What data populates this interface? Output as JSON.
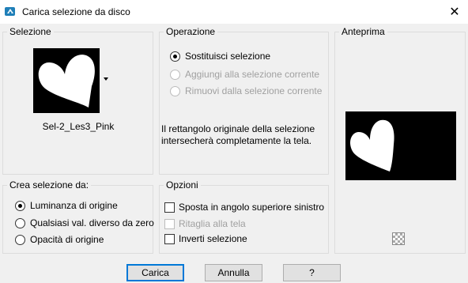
{
  "window": {
    "title": "Carica selezione da disco",
    "close_glyph": "✕",
    "icon": "paint-shop-icon"
  },
  "selezione": {
    "label": "Selezione",
    "filename": "Sel-2_Les3_Pink"
  },
  "operazione": {
    "label": "Operazione",
    "options": [
      {
        "label": "Sostituisci selezione",
        "checked": true,
        "enabled": true
      },
      {
        "label": "Aggiungi alla selezione corrente",
        "checked": false,
        "enabled": false
      },
      {
        "label": "Rimuovi dalla selezione corrente",
        "checked": false,
        "enabled": false
      }
    ],
    "info": "Il rettangolo originale della selezione intersecherà completamente la tela."
  },
  "anteprima": {
    "label": "Anteprima"
  },
  "crea": {
    "label": "Crea selezione da:",
    "options": [
      {
        "label": "Luminanza di origine",
        "checked": true
      },
      {
        "label": "Qualsiasi val. diverso da zero",
        "checked": false
      },
      {
        "label": "Opacità di origine",
        "checked": false
      }
    ]
  },
  "opzioni": {
    "label": "Opzioni",
    "items": [
      {
        "label": "Sposta in angolo superiore sinistro",
        "checked": false,
        "enabled": true
      },
      {
        "label": "Ritaglia alla tela",
        "checked": false,
        "enabled": false
      },
      {
        "label": "Inverti selezione",
        "checked": false,
        "enabled": true
      }
    ]
  },
  "buttons": {
    "load": "Carica",
    "cancel": "Annulla",
    "help": "?"
  }
}
